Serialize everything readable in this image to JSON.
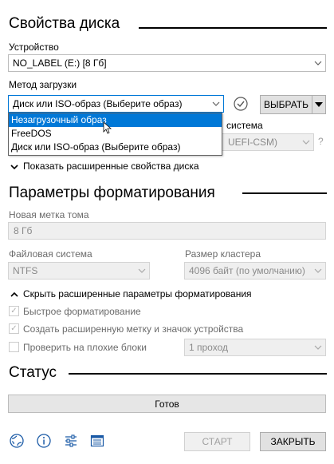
{
  "drive_properties": {
    "title": "Свойства диска",
    "device_label": "Устройство",
    "device_value": "NO_LABEL (E:) [8 Гб]",
    "boot_method_label": "Метод загрузки",
    "boot_method_value": "Диск или ISO-образ (Выберите образ)",
    "boot_method_options": [
      "Незагрузочный образ",
      "FreeDOS",
      "Диск или ISO-образ (Выберите образ)"
    ],
    "select_button": "ВЫБРАТЬ",
    "target_system_label_partial": "система",
    "target_system_value_partial": "UEFI-CSM)",
    "help_mark": "?",
    "advanced_toggle": "Показать расширенные свойства диска"
  },
  "format_options": {
    "title": "Параметры форматирования",
    "volume_label_label": "Новая метка тома",
    "volume_label_value": "8 Гб",
    "filesystem_label": "Файловая система",
    "filesystem_value": "NTFS",
    "cluster_size_label": "Размер кластера",
    "cluster_size_value": "4096 байт (по умолчанию)",
    "advanced_toggle": "Скрыть расширенные параметры форматирования",
    "quick_format_label": "Быстрое форматирование",
    "extended_label_label": "Создать расширенную метку и значок устройства",
    "bad_blocks_label": "Проверить на плохие блоки",
    "passes_value": "1 проход"
  },
  "status": {
    "title": "Статус",
    "text": "Готов"
  },
  "footer": {
    "start_button": "СТАРТ",
    "close_button": "ЗАКРЫТЬ"
  },
  "colors": {
    "accent": "#0078d7",
    "rule": "#000000"
  }
}
